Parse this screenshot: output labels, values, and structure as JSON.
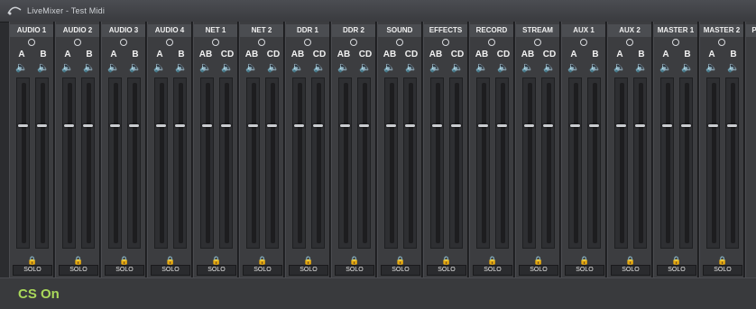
{
  "window": {
    "title": "LiveMixer - Test Midi"
  },
  "channels": [
    {
      "name": "AUDIO 1",
      "bus_left": "A",
      "bus_right": "B",
      "solo": "SOLO"
    },
    {
      "name": "AUDIO 2",
      "bus_left": "A",
      "bus_right": "B",
      "solo": "SOLO"
    },
    {
      "name": "AUDIO 3",
      "bus_left": "A",
      "bus_right": "B",
      "solo": "SOLO"
    },
    {
      "name": "AUDIO 4",
      "bus_left": "A",
      "bus_right": "B",
      "solo": "SOLO"
    },
    {
      "name": "NET 1",
      "bus_left": "AB",
      "bus_right": "CD",
      "solo": "SOLO"
    },
    {
      "name": "NET 2",
      "bus_left": "AB",
      "bus_right": "CD",
      "solo": "SOLO"
    },
    {
      "name": "DDR 1",
      "bus_left": "AB",
      "bus_right": "CD",
      "solo": "SOLO"
    },
    {
      "name": "DDR 2",
      "bus_left": "AB",
      "bus_right": "CD",
      "solo": "SOLO"
    },
    {
      "name": "SOUND",
      "bus_left": "AB",
      "bus_right": "CD",
      "solo": "SOLO"
    },
    {
      "name": "EFFECTS",
      "bus_left": "AB",
      "bus_right": "CD",
      "solo": "SOLO"
    },
    {
      "name": "RECORD",
      "bus_left": "AB",
      "bus_right": "CD",
      "solo": "SOLO"
    },
    {
      "name": "STREAM",
      "bus_left": "AB",
      "bus_right": "CD",
      "solo": "SOLO"
    },
    {
      "name": "AUX 1",
      "bus_left": "A",
      "bus_right": "B",
      "solo": "SOLO"
    },
    {
      "name": "AUX 2",
      "bus_left": "A",
      "bus_right": "B",
      "solo": "SOLO"
    },
    {
      "name": "MASTER 1",
      "bus_left": "A",
      "bus_right": "B",
      "solo": "SOLO"
    },
    {
      "name": "MASTER 2",
      "bus_left": "A",
      "bus_right": "B",
      "solo": "SOLO"
    },
    {
      "name": "P",
      "bus_left": "",
      "bus_right": "",
      "solo": ""
    }
  ],
  "status": {
    "text": "CS On"
  },
  "colors": {
    "accent": "#a9d85a",
    "strip": "#3c3d40"
  },
  "icons": {
    "speaker": "speaker-icon",
    "lock": "lock-icon",
    "knob": "knob-icon"
  }
}
